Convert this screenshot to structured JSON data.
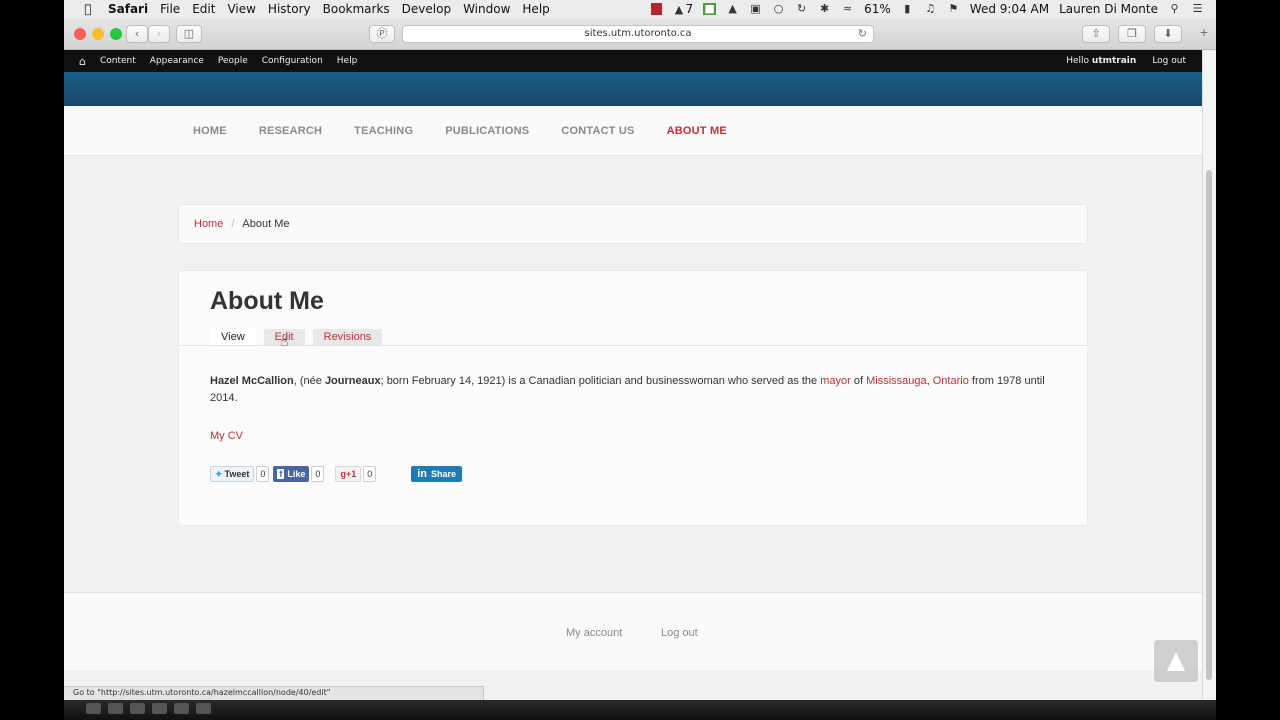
{
  "menubar": {
    "app": "Safari",
    "items": [
      "File",
      "Edit",
      "View",
      "History",
      "Bookmarks",
      "Develop",
      "Window",
      "Help"
    ],
    "battery": "61%",
    "clock": "Wed 9:04 AM",
    "user": "Lauren Di Monte",
    "tray_adobe": "7"
  },
  "browser": {
    "url": "sites.utm.utoronto.ca",
    "status": "Go to \"http://sites.utm.utoronto.ca/hazelmccallion/node/40/edit\""
  },
  "adminbar": {
    "items": [
      "Content",
      "Appearance",
      "People",
      "Configuration",
      "Help"
    ],
    "greeting": "Hello",
    "username": "utmtrain",
    "logout": "Log out"
  },
  "nav": {
    "items": [
      "HOME",
      "RESEARCH",
      "TEACHING",
      "PUBLICATIONS",
      "CONTACT US",
      "ABOUT ME"
    ]
  },
  "breadcrumb": {
    "home": "Home",
    "separator": "/",
    "current": "About Me"
  },
  "content": {
    "title": "About Me",
    "tabs": {
      "view": "View",
      "edit": "Edit",
      "revisions": "Revisions"
    },
    "body": {
      "name": "Hazel McCallion",
      "part1": ", (née ",
      "maiden": "Journeaux",
      "part2": "; born February 14, 1921) is a Canadian politician and businesswoman who served as the ",
      "link_mayor": "mayor",
      "part3": " of ",
      "link_city": "Mississauga",
      "part4": ", ",
      "link_province": "Ontario",
      "part5": " from 1978 until 2014."
    },
    "cv_link": "My CV",
    "share": {
      "tweet": "Tweet",
      "tweet_count": "0",
      "like": "Like",
      "like_count": "0",
      "gplus": "+1",
      "gplus_count": "0",
      "linkedin": "Share"
    }
  },
  "footer": {
    "my_account": "My account",
    "logout": "Log out"
  },
  "colors": {
    "accent": "#c0303a",
    "banner": "#1c5e86"
  }
}
